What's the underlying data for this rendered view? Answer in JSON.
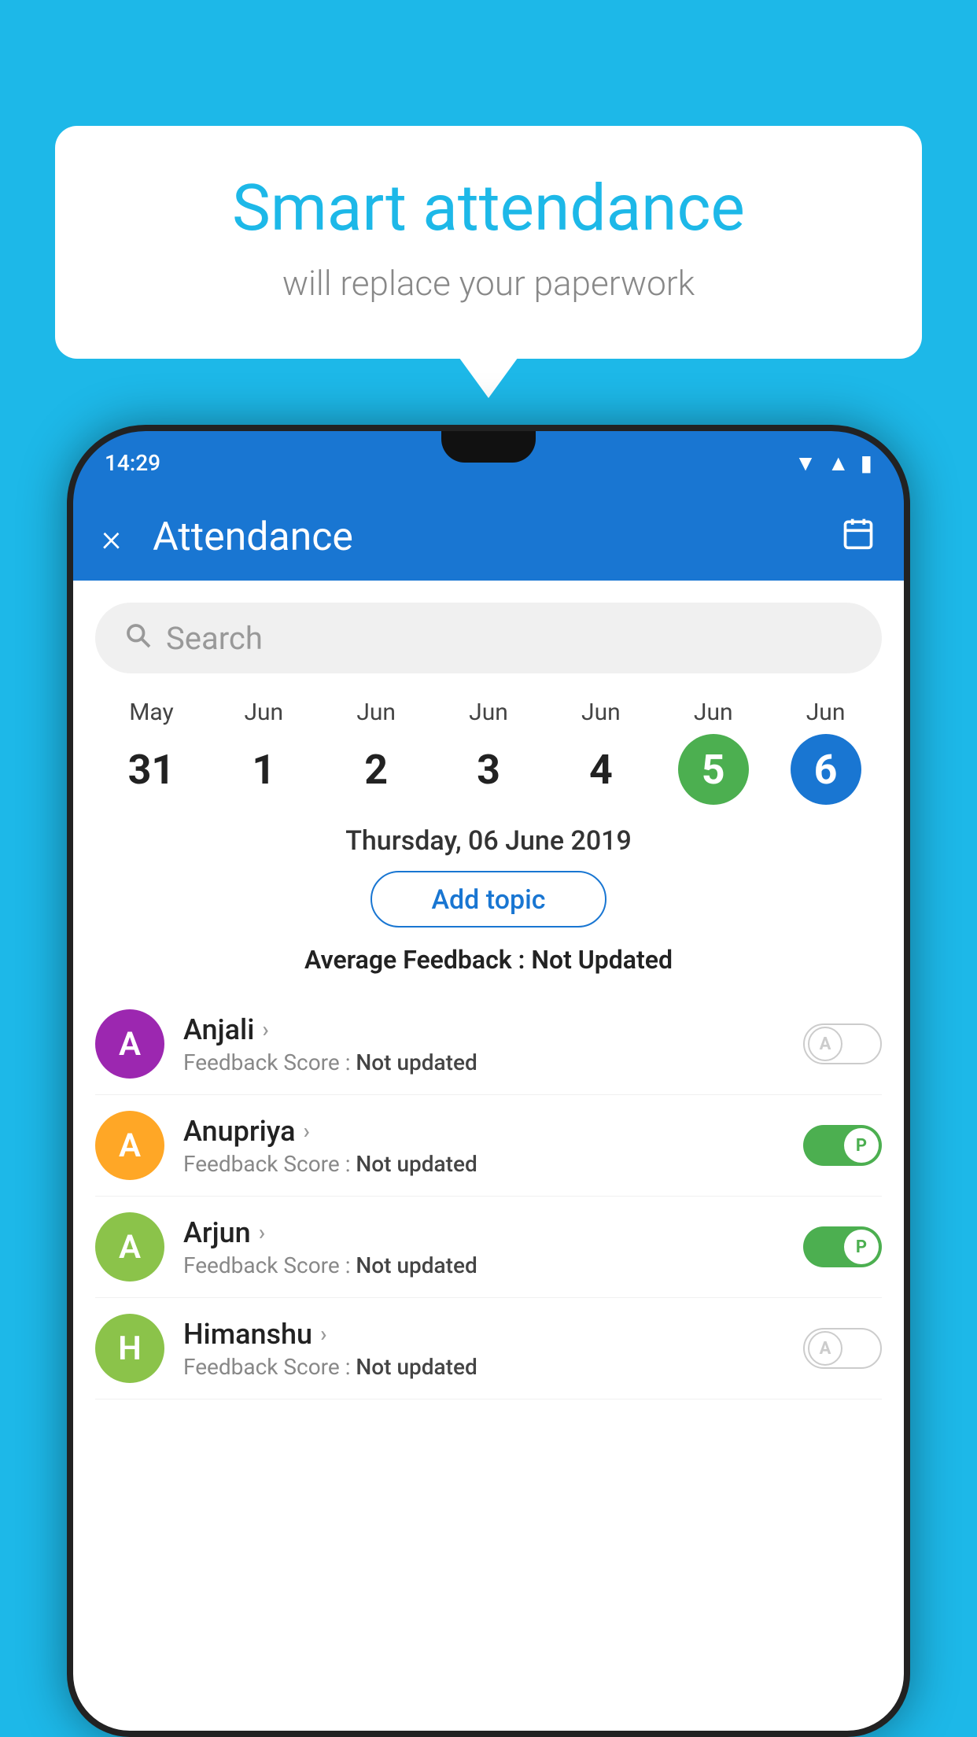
{
  "background_color": "#1DB8E8",
  "bubble": {
    "title": "Smart attendance",
    "subtitle": "will replace your paperwork"
  },
  "status_bar": {
    "time": "14:29"
  },
  "header": {
    "title": "Attendance",
    "close_label": "×",
    "calendar_icon": "calendar-icon"
  },
  "search": {
    "placeholder": "Search"
  },
  "calendar": {
    "days": [
      {
        "month": "May",
        "date": "31",
        "state": "normal"
      },
      {
        "month": "Jun",
        "date": "1",
        "state": "normal"
      },
      {
        "month": "Jun",
        "date": "2",
        "state": "normal"
      },
      {
        "month": "Jun",
        "date": "3",
        "state": "normal"
      },
      {
        "month": "Jun",
        "date": "4",
        "state": "normal"
      },
      {
        "month": "Jun",
        "date": "5",
        "state": "today"
      },
      {
        "month": "Jun",
        "date": "6",
        "state": "selected"
      }
    ]
  },
  "selected_date_label": "Thursday, 06 June 2019",
  "add_topic_label": "Add topic",
  "avg_feedback_prefix": "Average Feedback : ",
  "avg_feedback_value": "Not Updated",
  "students": [
    {
      "name": "Anjali",
      "avatar_letter": "A",
      "avatar_color": "#9C27B0",
      "feedback_prefix": "Feedback Score : ",
      "feedback_value": "Not updated",
      "toggle": "off",
      "toggle_letter": "A"
    },
    {
      "name": "Anupriya",
      "avatar_letter": "A",
      "avatar_color": "#FFA726",
      "feedback_prefix": "Feedback Score : ",
      "feedback_value": "Not updated",
      "toggle": "on",
      "toggle_letter": "P"
    },
    {
      "name": "Arjun",
      "avatar_letter": "A",
      "avatar_color": "#8BC34A",
      "feedback_prefix": "Feedback Score : ",
      "feedback_value": "Not updated",
      "toggle": "on",
      "toggle_letter": "P"
    },
    {
      "name": "Himanshu",
      "avatar_letter": "H",
      "avatar_color": "#8BC34A",
      "feedback_prefix": "Feedback Score : ",
      "feedback_value": "Not updated",
      "toggle": "off",
      "toggle_letter": "A"
    }
  ]
}
